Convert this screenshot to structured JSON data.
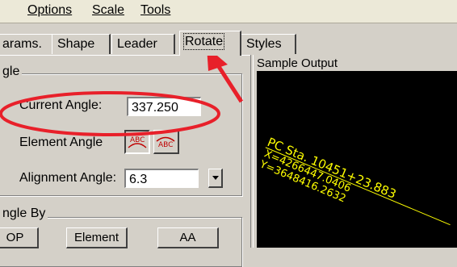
{
  "menu": {
    "items": [
      {
        "label": "Options"
      },
      {
        "label": "Scale"
      },
      {
        "label": "Tools"
      }
    ]
  },
  "tabs": [
    {
      "label": "arams."
    },
    {
      "label": "Shape"
    },
    {
      "label": "Leader"
    },
    {
      "label": "Rotate",
      "active": true
    },
    {
      "label": "Styles"
    }
  ],
  "angle_group": {
    "title": "gle",
    "current_angle_label": "Current Angle:",
    "current_angle_value": "337.250",
    "element_angle_label": "Element Angle",
    "alignment_angle_label": "Alignment Angle:",
    "alignment_angle_value": "6.3"
  },
  "angle_by_group": {
    "title": "ngle By",
    "buttons": [
      {
        "label": "OP"
      },
      {
        "label": "Element"
      },
      {
        "label": "AA"
      }
    ]
  },
  "sample_output": {
    "title": "Sample Output",
    "lines": [
      "PC Sta. 10451+23.883",
      "X=4266447.0406",
      "Y=3648416.2632"
    ]
  },
  "icons": {
    "element_angle_above": "text-above-arc-icon",
    "element_angle_below": "text-below-arc-icon",
    "dropdown": "dropdown-arrow-icon"
  },
  "annotation": {
    "highlight_color": "#e8202a"
  }
}
